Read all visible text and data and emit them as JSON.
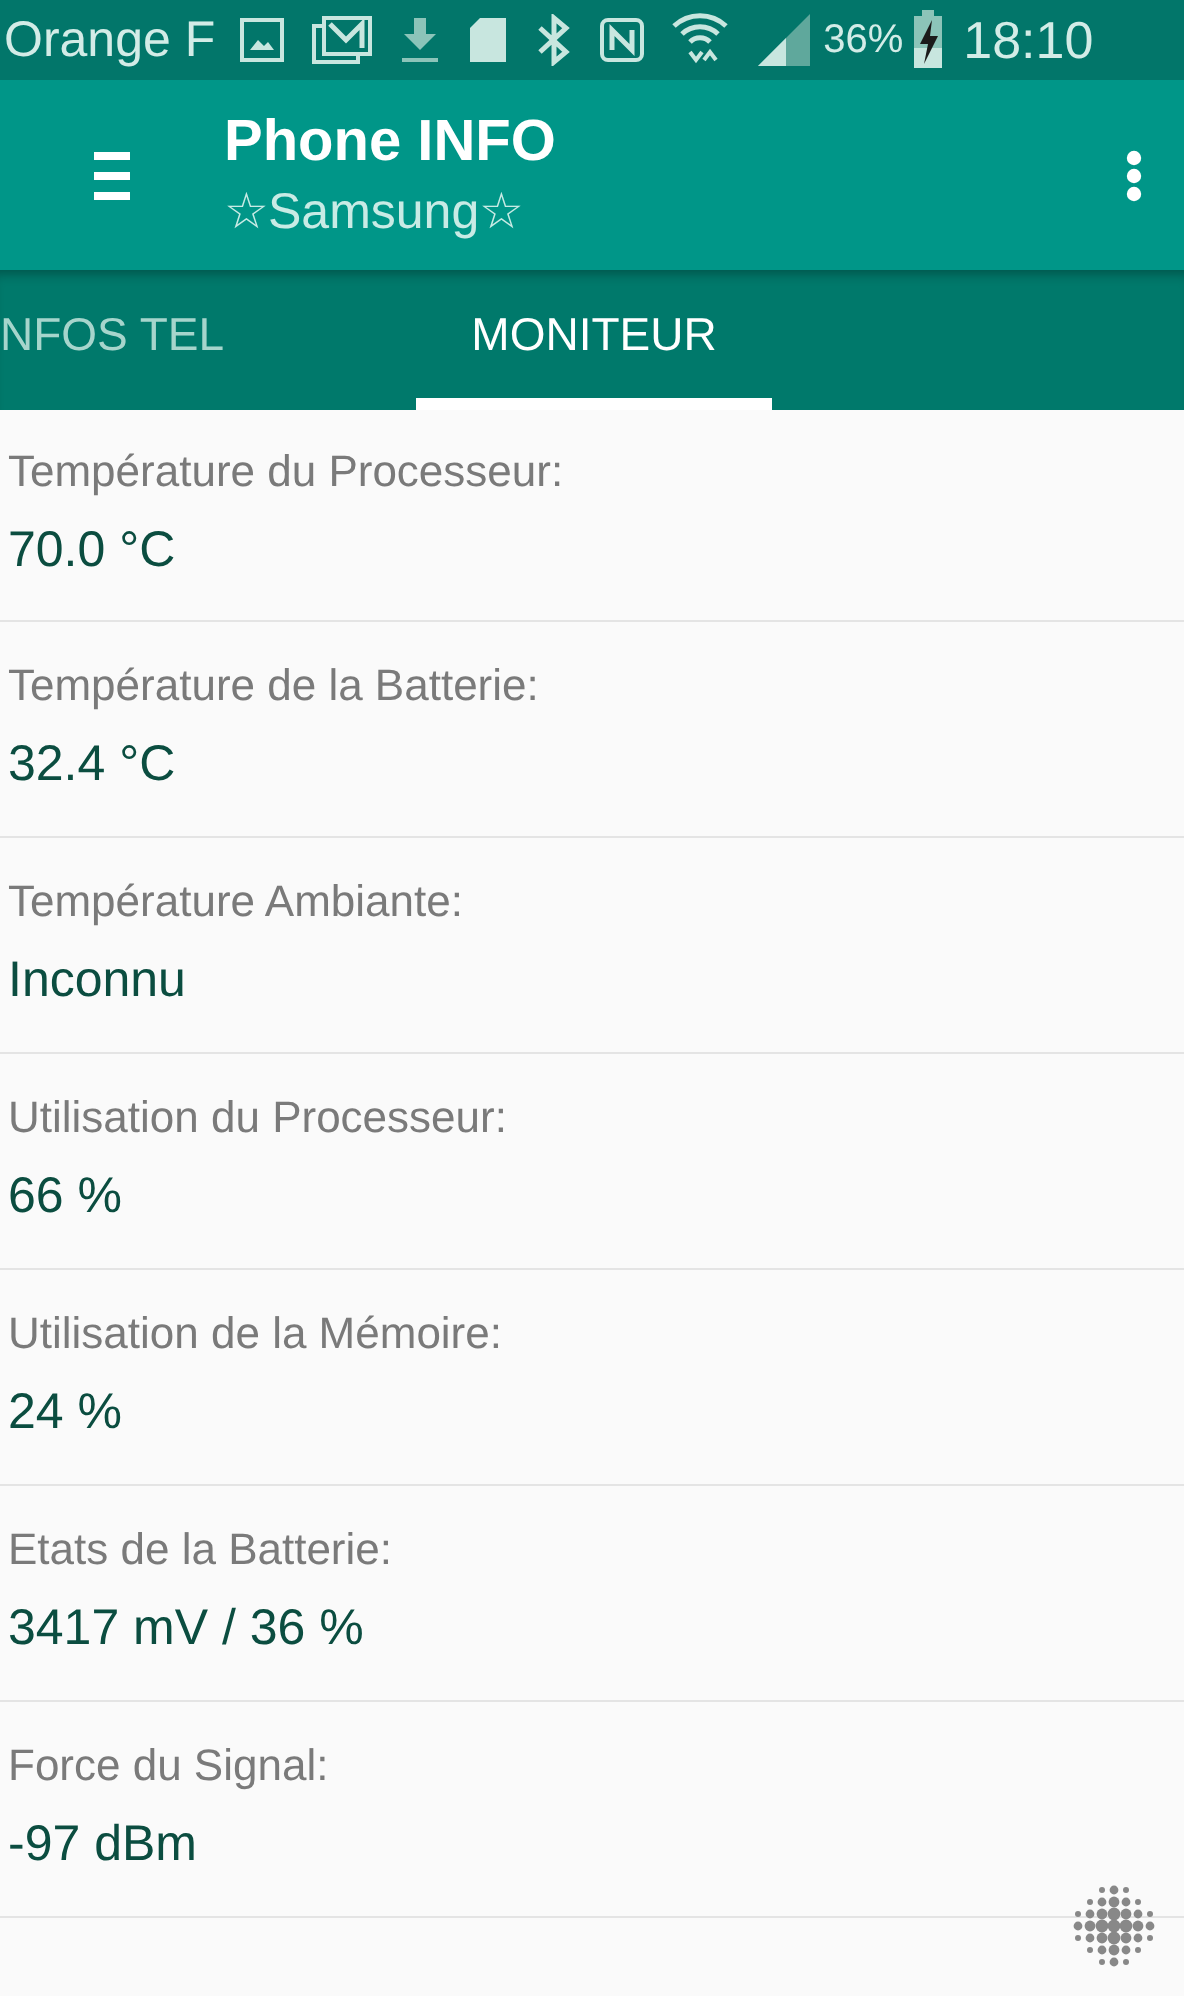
{
  "status_bar": {
    "carrier": "Orange F",
    "battery": "36%",
    "time": "18:10"
  },
  "app_bar": {
    "title": "Phone INFO",
    "subtitle": "☆Samsung☆"
  },
  "tabs": [
    {
      "label": "NFOS TEL",
      "selected": false
    },
    {
      "label": "MONITEUR",
      "selected": true
    }
  ],
  "items": [
    {
      "label": "Température du Processeur:",
      "value": "70.0 °C"
    },
    {
      "label": "Température de la Batterie:",
      "value": "32.4 °C"
    },
    {
      "label": "Température Ambiante:",
      "value": "Inconnu"
    },
    {
      "label": "Utilisation du Processeur:",
      "value": "66 %"
    },
    {
      "label": "Utilisation de la Mémoire:",
      "value": "24 %"
    },
    {
      "label": "Etats de la Batterie:",
      "value": "3417 mV / 36 %"
    },
    {
      "label": "Force du Signal:",
      "value": "-97 dBm"
    }
  ]
}
